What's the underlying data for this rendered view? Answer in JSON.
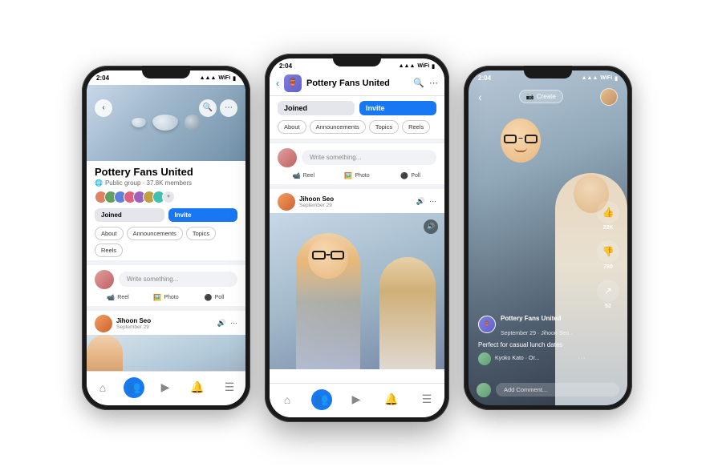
{
  "scene": {
    "background": "#ffffff"
  },
  "phone1": {
    "status_time": "2:04",
    "group_name": "Pottery Fans United",
    "group_meta": "Public group · 37.8K members",
    "btn_joined": "Joined",
    "btn_invite": "Invite",
    "tabs": [
      "About",
      "Announcements",
      "Topics",
      "Reels"
    ],
    "write_placeholder": "Write something...",
    "action_reel": "Reel",
    "action_photo": "Photo",
    "action_poll": "Poll",
    "poster_name": "Jihoon Seo",
    "poster_date": "September 29"
  },
  "phone2": {
    "status_time": "2:04",
    "group_name": "Pottery Fans United",
    "btn_joined": "Joined",
    "btn_invite": "Invite",
    "tabs": [
      "About",
      "Announcements",
      "Topics",
      "Reels"
    ],
    "write_placeholder": "Write something...",
    "action_reel": "Reel",
    "action_photo": "Photo",
    "action_poll": "Poll",
    "poster_name": "Jihoon Seo",
    "poster_date": "September 29"
  },
  "phone3": {
    "status_time": "2:04",
    "create_label": "Create",
    "like_count": "22K",
    "dislike_count": "780",
    "share_count": "52",
    "channel_name": "Pottery Fans United",
    "post_date": "September 29 · Jihoon Seo ·",
    "caption": "Perfect for casual lunch dates",
    "commenter": "Kyoko Kato · Or...",
    "comment_placeholder": "Add Comment..."
  }
}
